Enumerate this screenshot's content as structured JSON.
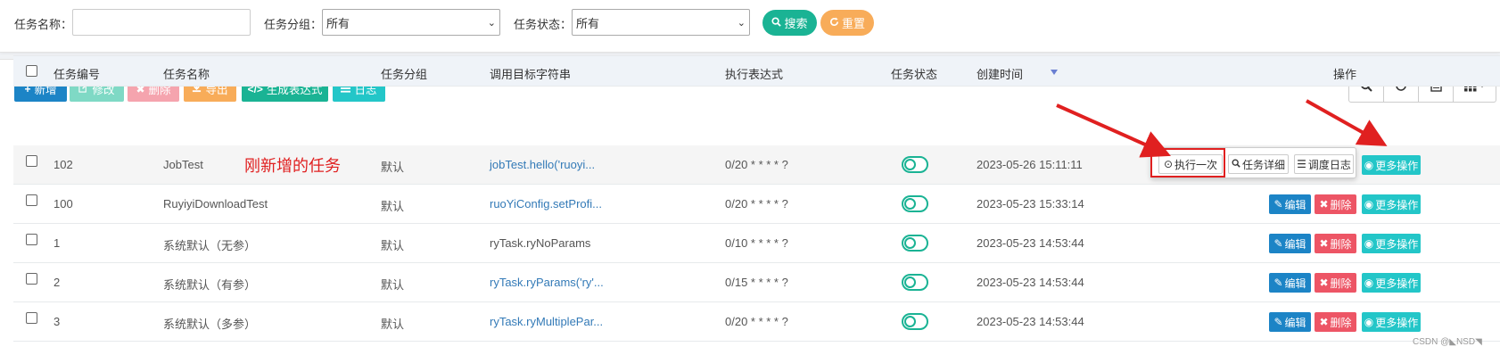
{
  "search": {
    "name_label": "任务名称：",
    "name_value": "",
    "group_label": "任务分组：",
    "group_selected": "所有",
    "status_label": "任务状态：",
    "status_selected": "所有",
    "search_button": "搜索",
    "reset_button": "重置"
  },
  "toolbar": {
    "add": "新增",
    "edit": "修改",
    "delete": "删除",
    "export": "导出",
    "generate_cron": "生成表达式",
    "log": "日志"
  },
  "table": {
    "headers": [
      "任务编号",
      "任务名称",
      "任务分组",
      "调用目标字符串",
      "执行表达式",
      "任务状态",
      "创建时间",
      "操作"
    ],
    "rows": [
      {
        "id": "102",
        "name": "JobTest",
        "group": "默认",
        "target": "jobTest.hello('ruoyi...",
        "cron": "0/20 * * * * ?",
        "created": "2023-05-26 15:11:11",
        "target_is_link": true
      },
      {
        "id": "100",
        "name": "RuyiyiDownloadTest",
        "group": "默认",
        "target": "ruoYiConfig.setProfi...",
        "cron": "0/20 * * * * ?",
        "created": "2023-05-23 15:33:14",
        "target_is_link": true
      },
      {
        "id": "1",
        "name": "系统默认（无参）",
        "group": "默认",
        "target": "ryTask.ryNoParams",
        "cron": "0/10 * * * * ?",
        "created": "2023-05-23 14:53:44",
        "target_is_link": false
      },
      {
        "id": "2",
        "name": "系统默认（有参）",
        "group": "默认",
        "target": "ryTask.ryParams('ry'...",
        "cron": "0/15 * * * * ?",
        "created": "2023-05-23 14:53:44",
        "target_is_link": true
      },
      {
        "id": "3",
        "name": "系统默认（多参）",
        "group": "默认",
        "target": "ryTask.ryMultiplePar...",
        "cron": "0/20 * * * * ?",
        "created": "2023-05-23 14:53:44",
        "target_is_link": true
      }
    ]
  },
  "row_actions": {
    "edit": "编辑",
    "delete": "删除",
    "more": "更多操作"
  },
  "popover": {
    "run_once": "执行一次",
    "detail": "任务详细",
    "schedule_log": "调度日志"
  },
  "annotation": "刚新增的任务",
  "watermark": "CSDN @◣NSD◥",
  "colors": {
    "primary": "#1c84c6",
    "success": "#1ab394",
    "warning": "#f8ac59",
    "danger": "#ed5565",
    "info": "#23c6c8",
    "annotation": "#e02020"
  }
}
